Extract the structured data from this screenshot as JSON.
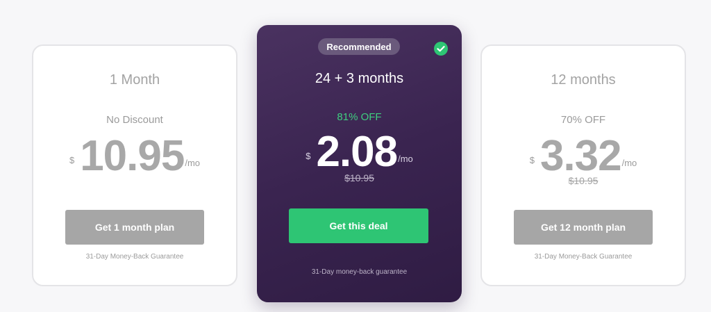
{
  "plans": {
    "left": {
      "title": "1 Month",
      "discount": "No Discount",
      "currency": "$",
      "price": "10.95",
      "per": "/mo",
      "old_price": "",
      "cta": "Get 1 month plan",
      "guarantee": "31-Day Money-Back Guarantee"
    },
    "featured": {
      "badge": "Recommended",
      "title": "24 + 3 months",
      "discount": "81% OFF",
      "currency": "$",
      "price": "2.08",
      "per": "/mo",
      "old_price": "$10.95",
      "cta": "Get this deal",
      "guarantee": "31-Day money-back guarantee"
    },
    "right": {
      "title": "12 months",
      "discount": "70% OFF",
      "currency": "$",
      "price": "3.32",
      "per": "/mo",
      "old_price": "$10.95",
      "cta": "Get 12 month plan",
      "guarantee": "31-Day Money-Back Guarantee"
    }
  },
  "colors": {
    "accent_green": "#2ec574",
    "featured_bg": "#3a2450",
    "disabled_button": "#a6a6a6"
  },
  "icons": {
    "selected": "check-circle-icon"
  }
}
